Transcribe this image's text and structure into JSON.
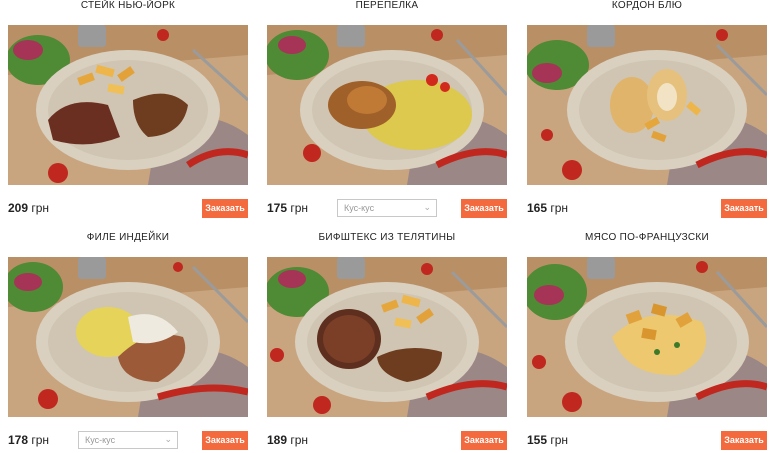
{
  "currency": "грн",
  "order_label": "Заказать",
  "side_select": {
    "placeholder": "Кус-кус"
  },
  "items": [
    {
      "title": "СТЕЙК НЬЮ-ЙОРК",
      "price": "209",
      "has_select": false,
      "dish": "steak"
    },
    {
      "title": "ПЕРЕПЕЛКА",
      "price": "175",
      "has_select": true,
      "dish": "quail"
    },
    {
      "title": "КОРДОН БЛЮ",
      "price": "165",
      "has_select": false,
      "dish": "cordon-bleu"
    },
    {
      "title": "ФИЛЕ ИНДЕЙКИ",
      "price": "178",
      "has_select": true,
      "dish": "turkey"
    },
    {
      "title": "БИФШТЕКС ИЗ ТЕЛЯТИНЫ",
      "price": "189",
      "has_select": false,
      "dish": "beefsteak"
    },
    {
      "title": "МЯСО ПО-ФРАНЦУЗСКИ",
      "price": "155",
      "has_select": false,
      "dish": "french-meat"
    }
  ],
  "colors": {
    "accent": "#f26a3d",
    "table": "#c9a57f",
    "plate": "#d9d0bf",
    "cloth": "#8b7f86"
  }
}
